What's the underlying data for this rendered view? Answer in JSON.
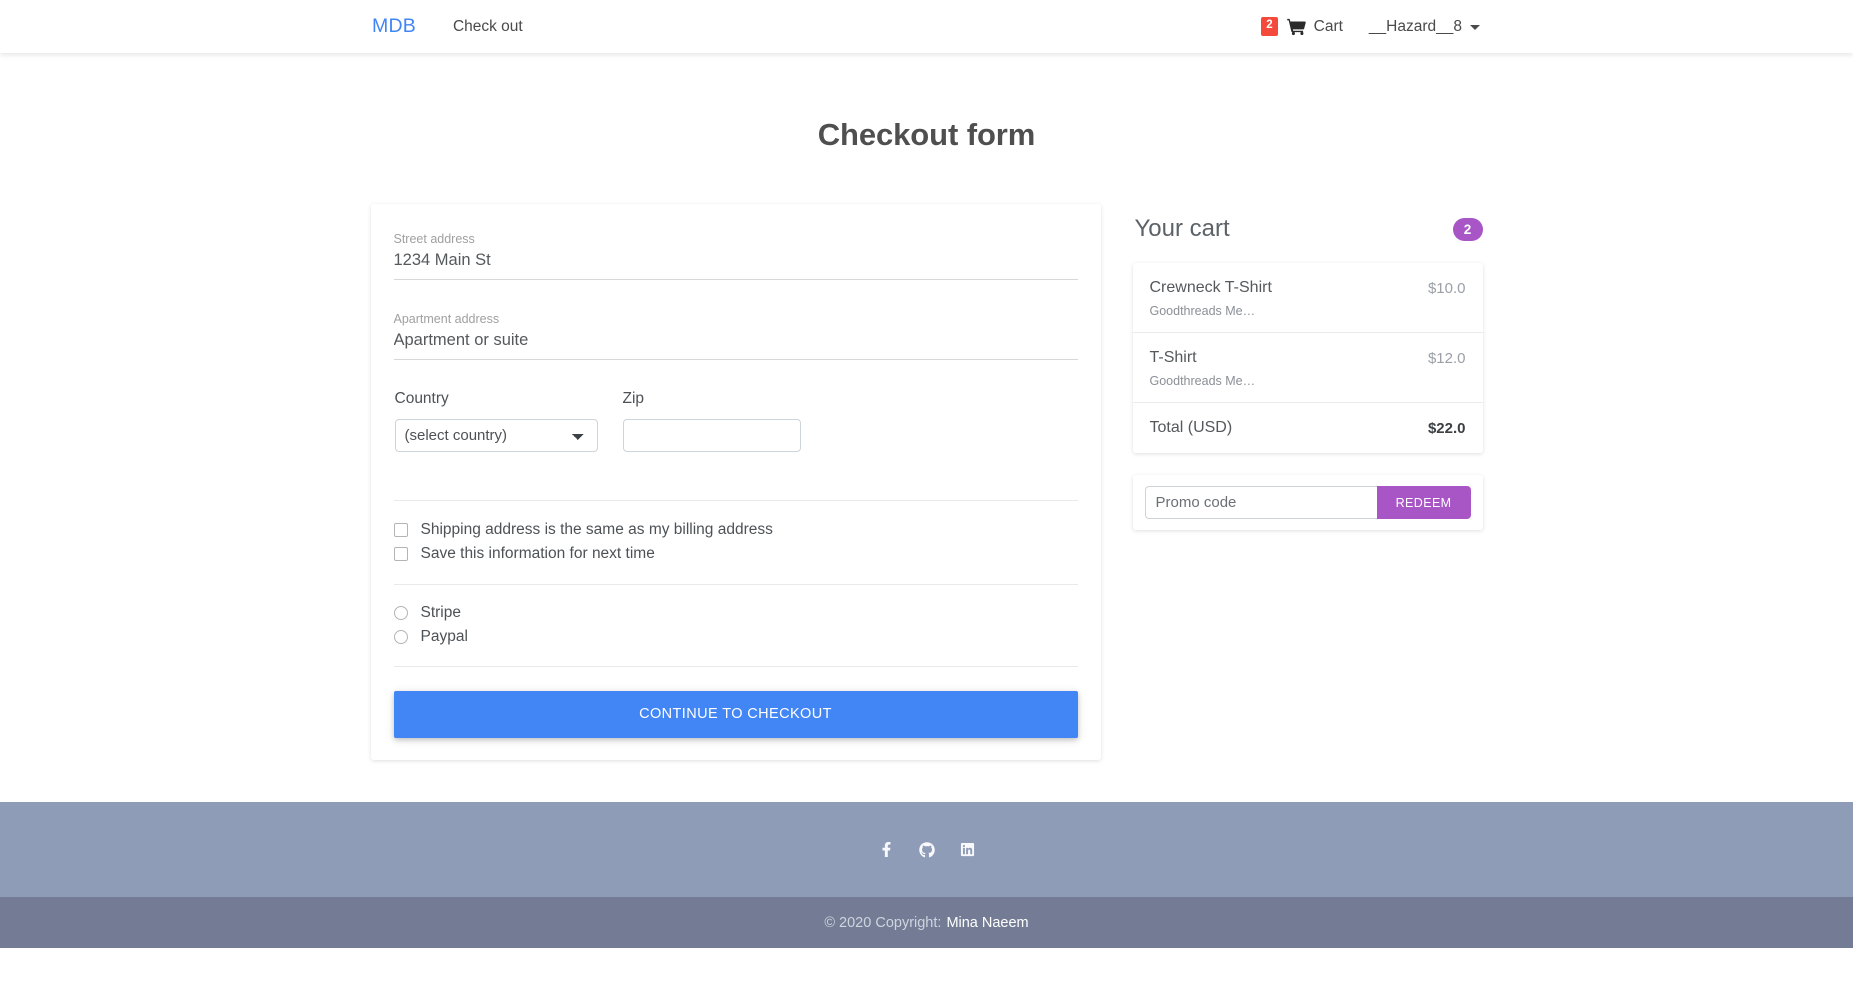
{
  "navbar": {
    "brand": "MDB",
    "link": "Check out",
    "cart_badge": "2",
    "cart_icon": "shopping-cart-icon",
    "cart_label": "Cart",
    "user": "__Hazard__8",
    "caret_icon": "chevron-down-icon",
    "brand_color": "#4285f4",
    "badge_color": "#f4493b"
  },
  "page": {
    "title": "Checkout form"
  },
  "form": {
    "street": {
      "label": "Street address",
      "value": "1234 Main St",
      "placeholder": "1234 Main St"
    },
    "apartment": {
      "label": "Apartment address",
      "value": "",
      "placeholder": "Apartment or suite"
    },
    "country": {
      "label": "Country",
      "selected": "(select country)",
      "options": [
        "(select country)"
      ]
    },
    "zip": {
      "label": "Zip",
      "value": "",
      "placeholder": ""
    },
    "checkboxes": [
      {
        "label": "Shipping address is the same as my billing address",
        "checked": false
      },
      {
        "label": "Save this information for next time",
        "checked": false
      }
    ],
    "payment_methods": [
      {
        "label": "Stripe",
        "selected": false
      },
      {
        "label": "Paypal",
        "selected": false
      }
    ],
    "submit_label": "CONTINUE TO CHECKOUT",
    "submit_color": "#4285f4"
  },
  "cart": {
    "title": "Your cart",
    "count": "2",
    "count_color": "#a855c6",
    "items": [
      {
        "name": "Crewneck T-Shirt",
        "subtitle": "Goodthreads Me…",
        "price": "$10.0"
      },
      {
        "name": "T-Shirt",
        "subtitle": "Goodthreads Me…",
        "price": "$12.0"
      }
    ],
    "total_label": "Total (USD)",
    "total_value": "$22.0",
    "promo": {
      "placeholder": "Promo code",
      "value": "",
      "button_label": "REDEEM",
      "button_color": "#a855c6"
    }
  },
  "footer": {
    "social": [
      {
        "name": "facebook-icon",
        "label": "Facebook"
      },
      {
        "name": "github-icon",
        "label": "GitHub"
      },
      {
        "name": "linkedin-icon",
        "label": "LinkedIn"
      }
    ],
    "copyright_prefix": "© 2020 Copyright:",
    "copyright_name": "Mina Naeem",
    "bg_color": "#8f9cb8",
    "bar_color": "#737c94"
  }
}
